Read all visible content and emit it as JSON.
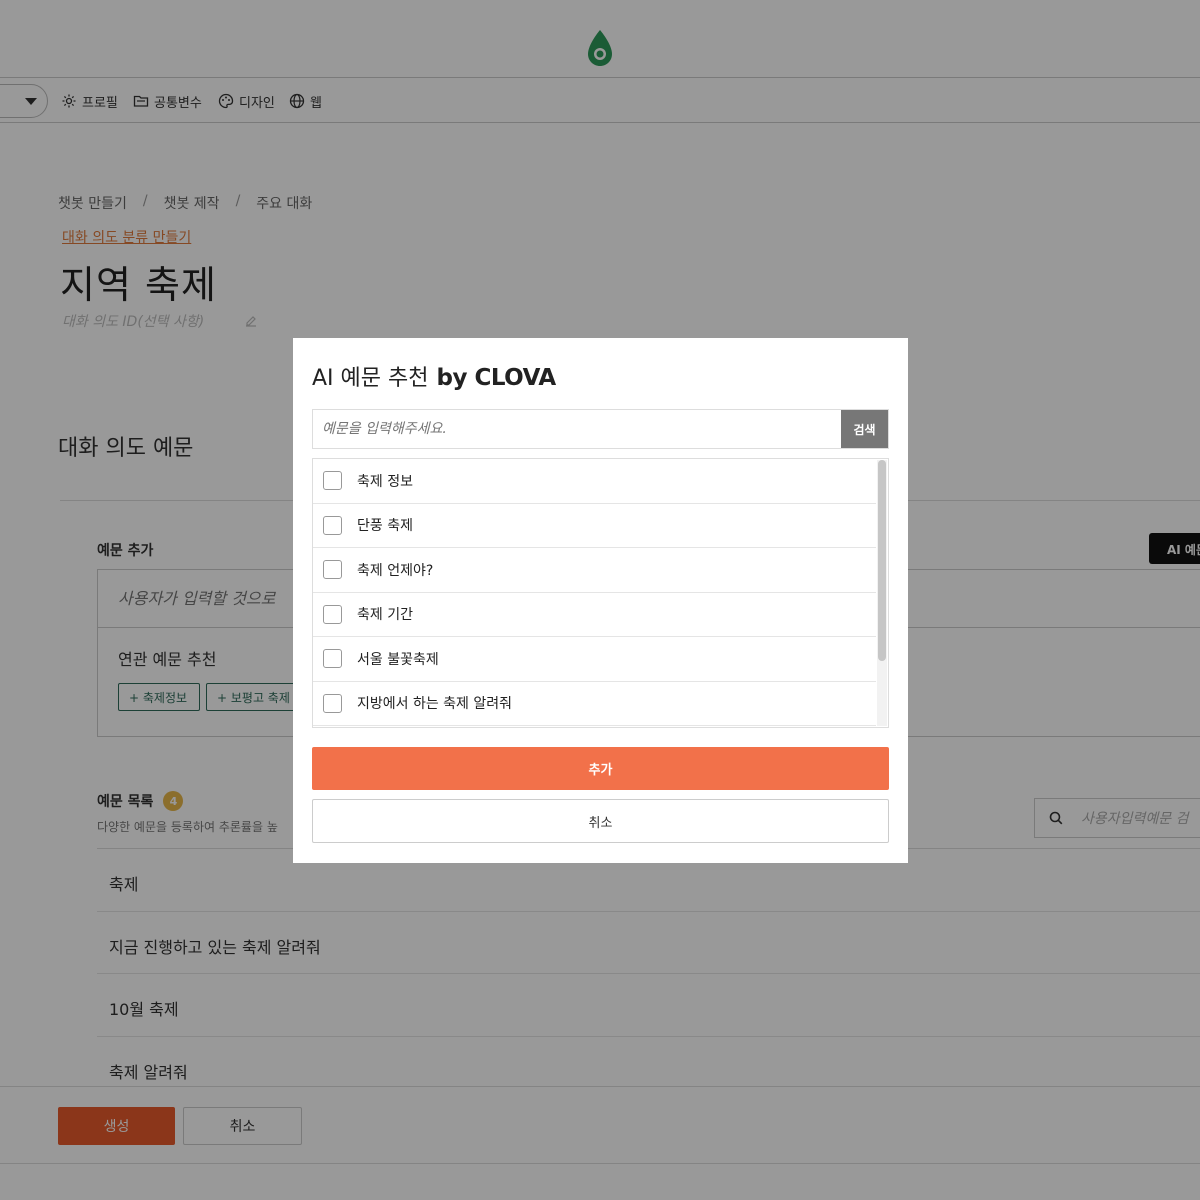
{
  "nav": {
    "items": [
      {
        "label": "프로필",
        "icon": "gear-icon"
      },
      {
        "label": "공통변수",
        "icon": "folder-icon"
      },
      {
        "label": "디자인",
        "icon": "palette-icon"
      },
      {
        "label": "웹",
        "icon": "globe-icon"
      }
    ]
  },
  "breadcrumb": [
    "챗봇 만들기",
    "챗봇 제작",
    "주요 대화"
  ],
  "breadcrumb_sep": "/",
  "intent_link": "대화 의도 분류 만들기",
  "page_title": "지역 축제",
  "intent_id_placeholder": "대화 의도 ID(선택 사항)",
  "section_title": "대화 의도 예문",
  "add_section": {
    "label": "예문 추가",
    "ai_button": "AI 예문",
    "input_placeholder": "사용자가 입력할 것으로",
    "related_title": "연관 예문 추천",
    "chips": [
      "+ 축제정보",
      "+ 보평고 축제"
    ]
  },
  "list_section": {
    "label": "예문 목록",
    "count": "4",
    "desc": "다양한 예문을 등록하여 추론률을 높",
    "search_placeholder": "사용자입력예문 검",
    "rows": [
      "축제",
      "지금 진행하고 있는 축제 알려줘",
      "10월 축제",
      "축제 알려줘"
    ]
  },
  "footer": {
    "create": "생성",
    "cancel": "취소"
  },
  "modal": {
    "title": "AI 예문 추천",
    "brand": "by CLOVA",
    "search_placeholder": "예문을 입력해주세요.",
    "search_button": "검색",
    "suggestions": [
      "축제 정보",
      "단풍 축제",
      "축제 언제야?",
      "축제 기간",
      "서울 불꽃축제",
      "지방에서 하는 축제 알려줘"
    ],
    "add_button": "추가",
    "cancel_button": "취소"
  },
  "colors": {
    "accent": "#f2714a",
    "create_button": "#e85a2c",
    "chip_border": "#2f6b5a",
    "link": "#e07b3c",
    "badge": "#e8b84a"
  }
}
